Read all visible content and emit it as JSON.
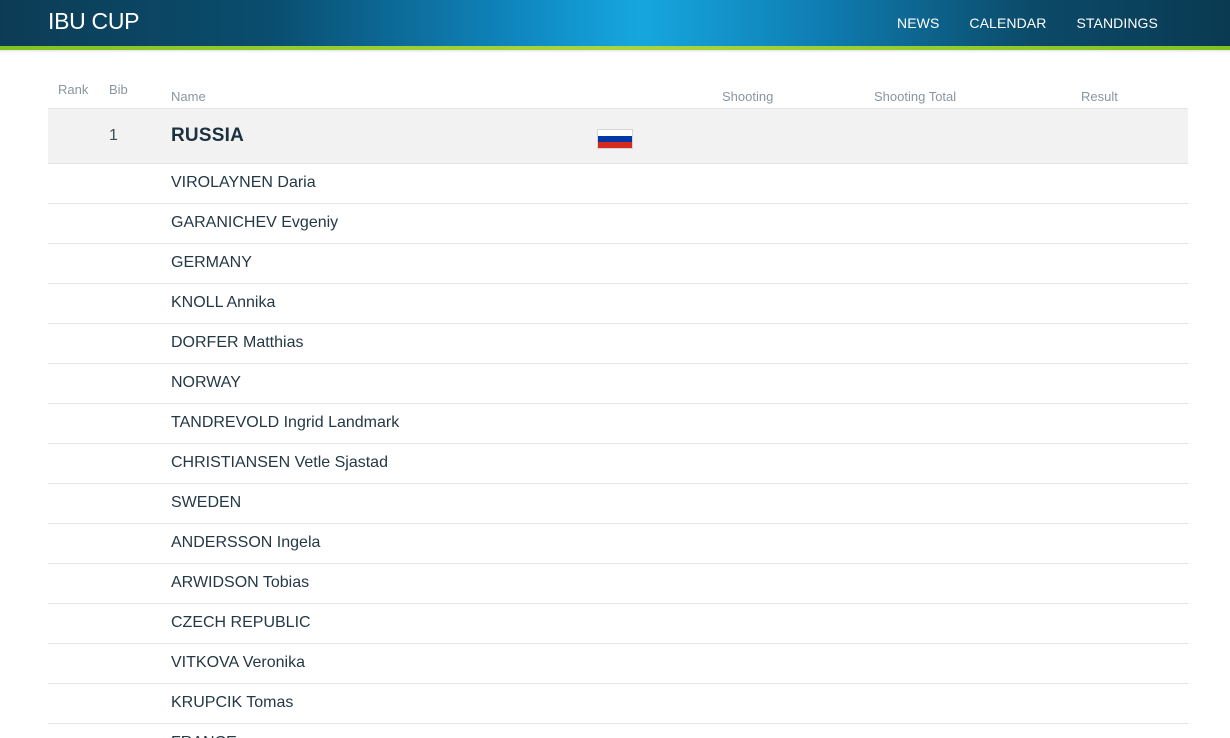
{
  "header": {
    "brand": "IBU CUP",
    "nav": [
      "NEWS",
      "CALENDAR",
      "STANDINGS"
    ]
  },
  "table": {
    "columns": {
      "rank": "Rank",
      "bib": "Bib",
      "name": "Name",
      "shooting": "Shooting",
      "shooting_total": "Shooting Total",
      "result": "Result"
    },
    "team": {
      "bib": "1",
      "name": "RUSSIA",
      "flag_colors": [
        "#ffffff",
        "#0039a6",
        "#d52b1e"
      ]
    },
    "rows": [
      "VIROLAYNEN Daria",
      "GARANICHEV Evgeniy",
      "GERMANY",
      "KNOLL Annika",
      "DORFER Matthias",
      "NORWAY",
      "TANDREVOLD Ingrid Landmark",
      "CHRISTIANSEN Vetle Sjastad",
      "SWEDEN",
      "ANDERSSON Ingela",
      "ARWIDSON Tobias",
      "CZECH REPUBLIC",
      "VITKOVA Veronika",
      "KRUPCIK Tomas",
      "FRANCE"
    ]
  },
  "colors": {
    "header_accent": "#16a7df",
    "header_stripe": "#7fc31f"
  }
}
